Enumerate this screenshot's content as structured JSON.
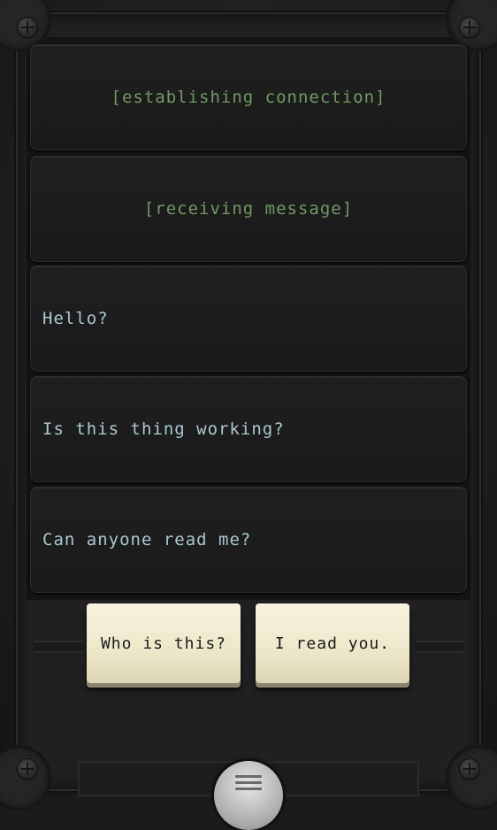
{
  "log": {
    "system_1": "[establishing connection]",
    "system_2": "[receiving message]",
    "message_1": "Hello?",
    "message_2": "Is this thing working?",
    "message_3": "Can anyone read me?"
  },
  "choices": {
    "option_1": "Who is this?",
    "option_2": "I read you."
  },
  "colors": {
    "system_text": "#6f9a62",
    "message_text": "#a9c8cf",
    "button_face": "#f0ead0"
  },
  "icons": {
    "menu": "hamburger-menu-icon",
    "screws": "screw-icon"
  }
}
